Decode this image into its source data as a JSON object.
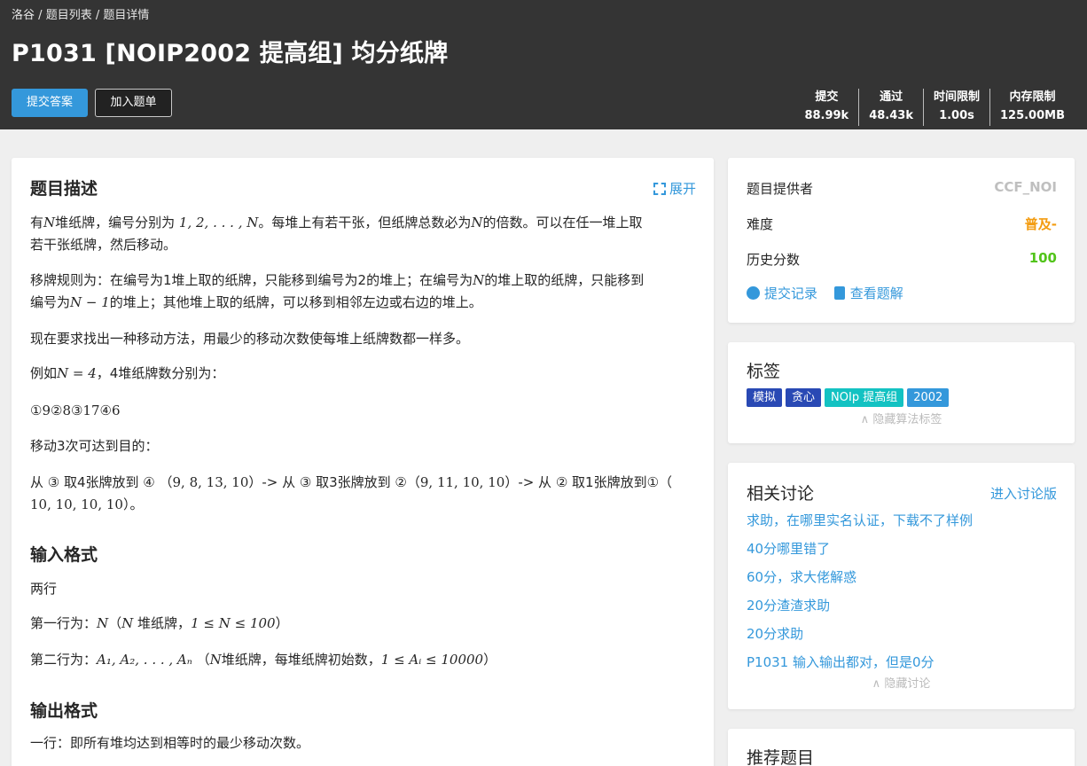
{
  "breadcrumb": {
    "home": "洛谷",
    "list": "题目列表",
    "detail": "题目详情",
    "sep": "/"
  },
  "problem": {
    "title": "P1031 [NOIP2002 提高组] 均分纸牌"
  },
  "actions": {
    "submit": "提交答案",
    "add_list": "加入题单"
  },
  "stats": [
    {
      "label": "提交",
      "value": "88.99k"
    },
    {
      "label": "通过",
      "value": "48.43k"
    },
    {
      "label": "时间限制",
      "value": "1.00s"
    },
    {
      "label": "内存限制",
      "value": "125.00MB"
    }
  ],
  "description": {
    "heading": "题目描述",
    "expand": "展开",
    "p1_a": "有",
    "p1_b": "堆纸牌，编号分别为 ",
    "p1_c": "。每堆上有若干张，但纸牌总数必为",
    "p1_d": "的倍数。可以在任一堆上取",
    "p1_line2": "若干张纸牌，然后移动。",
    "p2_a": "移牌规则为：在编号为1堆上取的纸牌，只能移到编号为2的堆上；在编号为",
    "p2_b": "的堆上取的纸牌，只能移到",
    "p2_c": "编号为",
    "p2_d": "的堆上；其他堆上取的纸牌，可以移到相邻左边或右边的堆上。",
    "p3": "现在要求找出一种移动方法，用最少的移动次数使每堆上纸牌数都一样多。",
    "p4_a": "例如",
    "p4_b": "，4堆纸牌数分别为：",
    "p5": "①9②8③17④6",
    "p6": "移动3次可达到目的：",
    "p7_a": "从 ③ 取4张牌放到 ④ （",
    "p7_b": "）-> 从 ③ 取3张牌放到 ②（",
    "p7_c": "）-> 从 ② 取1张牌放到①（",
    "p7_d": "）。"
  },
  "math": {
    "N": "N",
    "seq": "1, 2, . . . , N",
    "nm1": "N − 1",
    "neq4": "N = 4",
    "s1": "9, 8, 13, 10",
    "s2": "9, 11, 10, 10",
    "s3": "10, 10, 10, 10",
    "range1": "1 ≤ N ≤ 100",
    "arr": "A₁, A₂, . . . , Aₙ",
    "range2": "1 ≤ Aᵢ ≤ 10000"
  },
  "input": {
    "heading": "输入格式",
    "l1": "两行",
    "l2_a": "第一行为：",
    "l2_b": "（",
    "l2_c": " 堆纸牌，",
    "l2_d": "）",
    "l3_a": "第二行为：",
    "l3_b": " （",
    "l3_c": "堆纸牌，每堆纸牌初始数，",
    "l3_d": "）"
  },
  "output": {
    "heading": "输出格式",
    "l1": "一行：即所有堆均达到相等时的最少移动次数。"
  },
  "info": {
    "provider_label": "题目提供者",
    "provider": "CCF_NOI",
    "difficulty_label": "难度",
    "difficulty": "普及-",
    "history_label": "历史分数",
    "history": "100",
    "records": "提交记录",
    "solutions": "查看题解",
    "colors": {
      "provider": "#bfbfbf",
      "difficulty": "#f39c11",
      "history": "#52c41a"
    }
  },
  "tags": {
    "heading": "标签",
    "items": [
      {
        "label": "模拟",
        "color": "#2949b4"
      },
      {
        "label": "贪心",
        "color": "#2949b4"
      },
      {
        "label": "NOIp 提高组",
        "color": "#13c2c2"
      },
      {
        "label": "2002",
        "color": "#3498db"
      }
    ],
    "hide": "∧ 隐藏算法标签"
  },
  "discuss": {
    "heading": "相关讨论",
    "enter": "进入讨论版",
    "items": [
      "求助，在哪里实名认证，下载不了样例",
      "40分哪里错了",
      "60分，求大佬解惑",
      "20分渣渣求助",
      "20分求助",
      "P1031 输入输出都对，但是0分"
    ],
    "hide": "∧ 隐藏讨论"
  },
  "recommend": {
    "heading": "推荐题目"
  }
}
